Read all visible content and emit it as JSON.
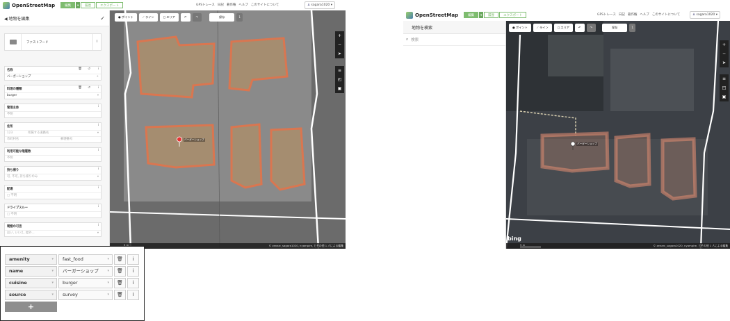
{
  "left": {
    "header": {
      "app_name": "OpenStreetMap",
      "edit_label": "編集",
      "dropdown_arrow": "▾",
      "history_label": "履歴",
      "export_label": "エクスポート",
      "links": [
        "GPSトレース",
        "日記",
        "著作権",
        "ヘルプ",
        "このサイトについて"
      ],
      "user": "sagara1020"
    },
    "sidebar": {
      "title": "地物を編集",
      "back_glyph": "◀",
      "done_glyph": "✓",
      "preset_name": "ファストフード",
      "info_glyph": "i",
      "fields": [
        {
          "label": "名称",
          "value": "バーガーショップ",
          "placeholder": false,
          "icons": [
            "🗑",
            "↺",
            "i"
          ],
          "extra": "+"
        },
        {
          "label": "料理の種類",
          "value": "burger",
          "placeholder": false,
          "icons": [
            "🗑",
            "↺",
            "i"
          ],
          "extra": "▾"
        },
        {
          "label": "管理主体",
          "value": "不明",
          "placeholder": true,
          "icons": [
            "i"
          ],
          "extra": ""
        },
        {
          "label": "住所",
          "value": "123",
          "value2": "所属する道路名",
          "value3": "市町村名",
          "value4": "郵便番号",
          "placeholder": true,
          "icons": [
            "i"
          ],
          "extra": "▾"
        },
        {
          "label": "利用可能な階層数",
          "value": "不明",
          "placeholder": true,
          "icons": [
            "i"
          ],
          "extra": ""
        },
        {
          "label": "持ち帰り",
          "value": "可, 不可, 持ち帰りのみ",
          "placeholder": true,
          "icons": [
            "i"
          ],
          "extra": "▾"
        },
        {
          "label": "配達",
          "value": "□ 不明",
          "placeholder": true,
          "icons": [
            "i"
          ],
          "extra": ""
        },
        {
          "label": "ドライブスルー",
          "value": "□ 不明",
          "placeholder": true,
          "icons": [
            "i"
          ],
          "extra": ""
        },
        {
          "label": "喫煙の可否",
          "value": "はい, いいえ, 屋外...",
          "placeholder": true,
          "icons": [
            "i"
          ],
          "extra": "▾"
        }
      ]
    },
    "map": {
      "toolbar": {
        "point": "ポイント",
        "line": "ライン",
        "area": "エリア",
        "undo": "↶",
        "redo": "↷",
        "save": "保存",
        "count": "1"
      },
      "controls": [
        "+",
        "−",
        "➤",
        "≡",
        "◰",
        "▣"
      ],
      "scale": "5 m",
      "label": "バーガーショップ",
      "attribution": "© zenarc_sagara1020, nyampire, とその他 1 人による編集"
    }
  },
  "right": {
    "header": {
      "app_name": "OpenStreetMap",
      "edit_label": "編集",
      "dropdown_arrow": "▾",
      "history_label": "履歴",
      "export_label": "エクスポート",
      "links": [
        "GPSトレース",
        "日記",
        "著作権",
        "ヘルプ",
        "このサイトについて"
      ],
      "user": "sagara1020"
    },
    "sidebar": {
      "title": "地物を検索",
      "search_placeholder": "検索",
      "search_glyph": "🔍"
    },
    "map": {
      "toolbar": {
        "point": "ポイント",
        "line": "ライン",
        "area": "エリア",
        "undo": "↶",
        "redo": "↷",
        "save": "保存",
        "count": "1"
      },
      "controls": [
        "+",
        "−",
        "➤",
        "≡",
        "◰",
        "▣"
      ],
      "scale": "5 m",
      "label": "バーガーショップ",
      "bing": "bing",
      "attribution": "© zenarc_sagara1020, nyampire, とその他 1 人による編集"
    }
  },
  "tag_table": {
    "rows": [
      {
        "key": "amenity",
        "value": "fast_food"
      },
      {
        "key": "name",
        "value": "バーガーショップ"
      },
      {
        "key": "cuisine",
        "value": "burger"
      },
      {
        "key": "source",
        "value": "survey"
      }
    ],
    "delete_glyph": "🗑",
    "info_glyph": "i",
    "add_glyph": "+",
    "dropdown_glyph": "▾"
  }
}
